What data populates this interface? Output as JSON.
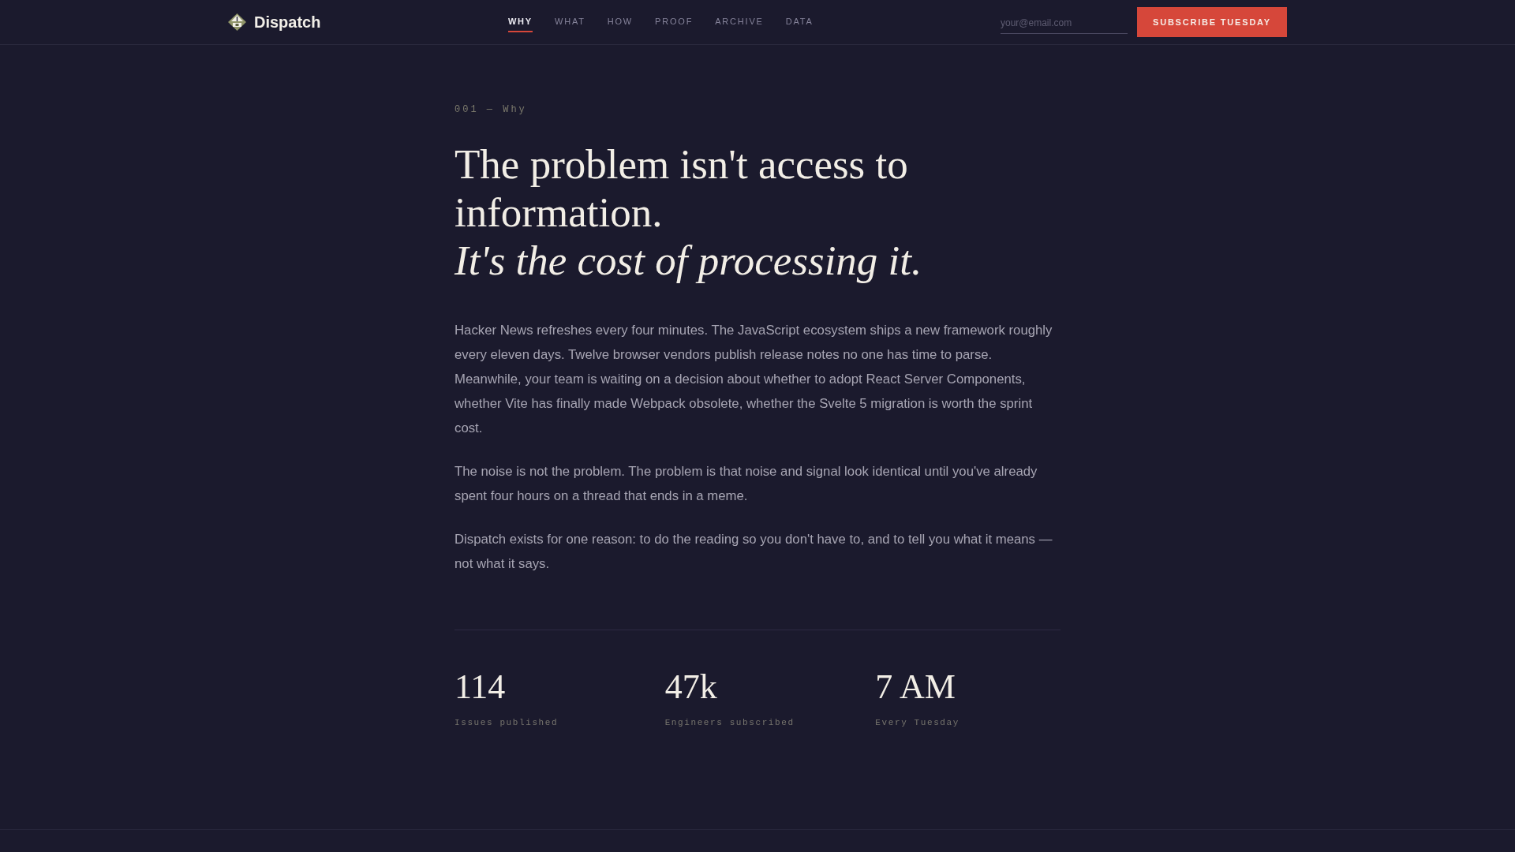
{
  "header": {
    "brand": "Dispatch",
    "nav": [
      {
        "label": "WHY",
        "selected": true
      },
      {
        "label": "WHAT",
        "selected": false
      },
      {
        "label": "HOW",
        "selected": false
      },
      {
        "label": "PROOF",
        "selected": false
      },
      {
        "label": "ARCHIVE",
        "selected": false
      },
      {
        "label": "DATA",
        "selected": false
      }
    ],
    "email_field": {
      "placeholder": "your@email.com"
    },
    "subscribe_button": "SUBSCRIBE TUESDAY"
  },
  "section": {
    "eyebrow": "001 — Why",
    "headline": "The problem isn't access to information. *It's the cost of processing it.*",
    "paragraphs": [
      "Hacker News refreshes every four minutes. The JavaScript ecosystem ships a new framework roughly every eleven days. Twelve browser vendors publish release notes no one has time to parse. Meanwhile, your team is waiting on a decision about whether to adopt React Server Components, whether Vite has finally made Webpack obsolete, whether the Svelte 5 migration is worth the sprint cost.",
      "The noise is not the problem. The problem is that noise and signal look identical until you've already spent four hours on a thread that ends in a meme.",
      "Dispatch exists for one reason: to do the reading so you don't have to, and to tell you what it means — not what it says."
    ],
    "stats": [
      {
        "value": "114",
        "label": "Issues published"
      },
      {
        "value": "47k",
        "label": "Engineers subscribed"
      },
      {
        "value": "7 AM",
        "label": "Every Tuesday"
      }
    ]
  }
}
